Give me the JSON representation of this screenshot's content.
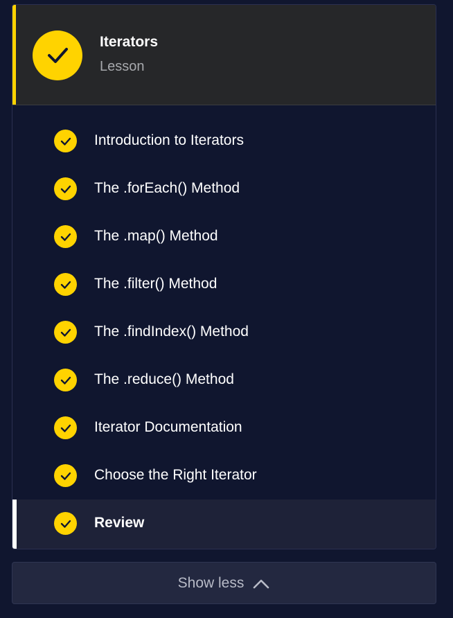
{
  "colors": {
    "background": "#10162f",
    "header_bg": "#262729",
    "accent": "#ffd300",
    "active_row": "#1e2238",
    "button_bg": "#232840"
  },
  "header": {
    "title": "Iterators",
    "subtitle": "Lesson",
    "icon": "check-icon"
  },
  "items": [
    {
      "label": "Introduction to Iterators",
      "completed": true
    },
    {
      "label": "The .forEach() Method",
      "completed": true
    },
    {
      "label": "The .map() Method",
      "completed": true
    },
    {
      "label": "The .filter() Method",
      "completed": true
    },
    {
      "label": "The .findIndex() Method",
      "completed": true
    },
    {
      "label": "The .reduce() Method",
      "completed": true
    },
    {
      "label": "Iterator Documentation",
      "completed": true
    },
    {
      "label": "Choose the Right Iterator",
      "completed": true
    },
    {
      "label": "Review",
      "completed": true,
      "active": true
    }
  ],
  "footer": {
    "show_less_label": "Show less",
    "icon": "chevron-up-icon"
  }
}
